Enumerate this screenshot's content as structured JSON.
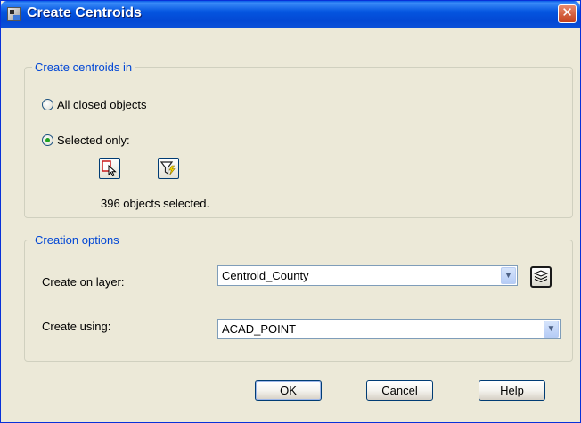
{
  "window": {
    "title": "Create Centroids",
    "close_glyph": "✕"
  },
  "create_in": {
    "legend": "Create centroids in",
    "option_all": "All closed objects",
    "option_selected": "Selected only:",
    "selected_choice": "Selected only:",
    "select_icon": "select-objects-icon",
    "filter_icon": "quick-select-filter-icon",
    "status": "396 objects selected."
  },
  "options": {
    "legend": "Creation options",
    "layer_label": "Create on layer:",
    "layer_value": "Centroid_County",
    "layer_manager_icon": "layer-manager-icon",
    "using_label": "Create using:",
    "using_value": "ACAD_POINT"
  },
  "buttons": {
    "ok": "OK",
    "cancel": "Cancel",
    "help": "Help"
  },
  "colors": {
    "accent": "#0046D5",
    "title_bar": "#0556E0",
    "dialog_bg": "#ECE9D8"
  }
}
